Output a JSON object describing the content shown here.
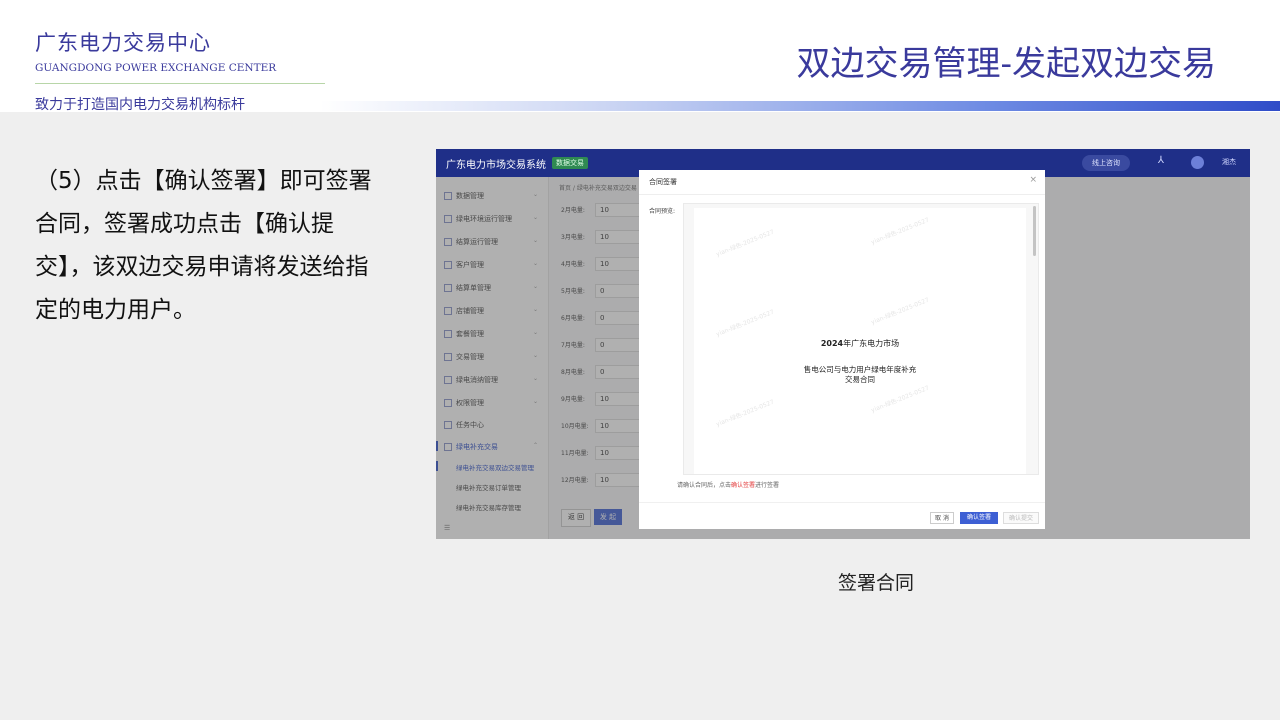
{
  "header": {
    "org_name_cn": "广东电力交易中心",
    "org_name_en": "GUANGDONG POWER EXCHANGE CENTER",
    "slogan": "致力于打造国内电力交易机构标杆",
    "page_title": "双边交易管理-发起双边交易"
  },
  "instruction": "（5）点击【确认签署】即可签署合同，签署成功点击【确认提交】，该双边交易申请将发送给指定的电力用户。",
  "screenshot": {
    "app_title": "广东电力市场交易系统",
    "env_tag": "数据交易",
    "online_button": "线上咨询",
    "network_icon": "⅄",
    "user_name": "湘杰",
    "sidebar": [
      {
        "label": "数据管理",
        "chevron": "⌄"
      },
      {
        "label": "绿电环境运行管理",
        "chevron": "⌄"
      },
      {
        "label": "结算运行管理",
        "chevron": "⌄"
      },
      {
        "label": "客户管理",
        "chevron": "⌄"
      },
      {
        "label": "结算单管理",
        "chevron": "⌄"
      },
      {
        "label": "店铺管理",
        "chevron": "⌄"
      },
      {
        "label": "套餐管理",
        "chevron": "⌄"
      },
      {
        "label": "交易管理",
        "chevron": "⌄"
      },
      {
        "label": "绿电消纳管理",
        "chevron": "⌄"
      },
      {
        "label": "权限管理",
        "chevron": "⌄"
      },
      {
        "label": "任务中心",
        "chevron": ""
      },
      {
        "label": "绿电补充交易",
        "chevron": "⌃"
      }
    ],
    "sidebar_sub": [
      "绿电补充交易双边交易管理",
      "绿电补充交易订单管理",
      "绿电补充交易库存管理"
    ],
    "sidebar_collapse": "☰",
    "breadcrumb": "首页  /  绿电补充交易双边交易",
    "form_rows": [
      {
        "label": "2月电量:",
        "value": "10"
      },
      {
        "label": "3月电量:",
        "value": "10"
      },
      {
        "label": "4月电量:",
        "value": "10"
      },
      {
        "label": "5月电量:",
        "value": "0"
      },
      {
        "label": "6月电量:",
        "value": "0"
      },
      {
        "label": "7月电量:",
        "value": "0"
      },
      {
        "label": "8月电量:",
        "value": "0"
      },
      {
        "label": "9月电量:",
        "value": "10"
      },
      {
        "label": "10月电量:",
        "value": "10"
      },
      {
        "label": "11月电量:",
        "value": "10"
      },
      {
        "label": "12月电量:",
        "value": "10"
      }
    ],
    "back_button": "返 回",
    "submit_button": "发 起",
    "modal": {
      "title": "合同签署",
      "close": "×",
      "preview_label": "合同预览:",
      "doc_year": "2024",
      "doc_year_suffix": "年广东电力市场",
      "doc_name_line1": "售电公司与电力用户绿电年度补充",
      "doc_name_line2": "交易合同",
      "watermark": "yian-绿色-2025-0527",
      "hint_before": "请确认合同后，点击",
      "hint_link": "确认签署",
      "hint_after": "进行签署",
      "cancel_button": "取 消",
      "sign_button": "确认签署",
      "confirm_submit_button": "确认提交"
    }
  },
  "caption": "签署合同",
  "colors": {
    "brand_blue": "#3a3a9c",
    "nav_dark": "#1f2f88",
    "primary_button": "#3d5fd4",
    "hint_red": "#e23a3a"
  }
}
